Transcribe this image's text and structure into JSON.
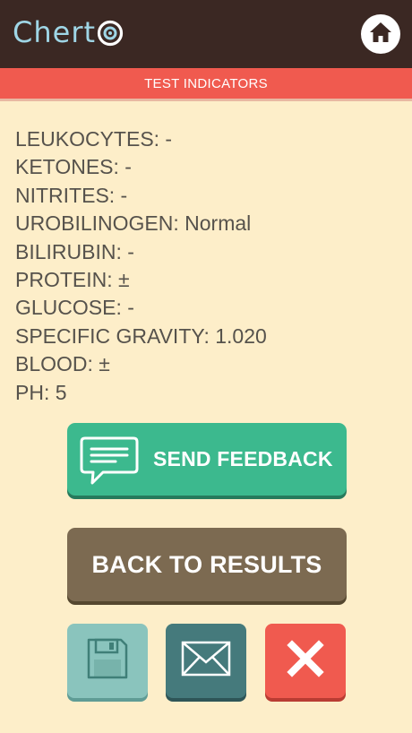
{
  "header": {
    "logo_text": "Chert",
    "home_icon": "home-icon"
  },
  "section": {
    "title": "TEST INDICATORS"
  },
  "indicators": [
    "LEUKOCYTES: -",
    "KETONES: -",
    "NITRITES: -",
    "UROBILINOGEN: Normal",
    "BILIRUBIN: -",
    "PROTEIN: ±",
    "GLUCOSE: -",
    "SPECIFIC GRAVITY: 1.020",
    "BLOOD: ±",
    "PH: 5"
  ],
  "actions": {
    "feedback_label": "SEND FEEDBACK",
    "feedback_icon": "chat-bubble-icon",
    "back_label": "BACK TO RESULTS",
    "save_icon": "floppy-disk-icon",
    "mail_icon": "envelope-icon",
    "close_icon": "close-icon"
  },
  "colors": {
    "header_bg": "#3b2823",
    "accent_red": "#f05a4f",
    "page_bg": "#fdeec9",
    "feedback_green": "#3cb98e",
    "back_brown": "#7c6a51",
    "save_teal": "#8ac4bd",
    "mail_teal": "#457a7c",
    "logo_blue": "#9fd6e6"
  }
}
